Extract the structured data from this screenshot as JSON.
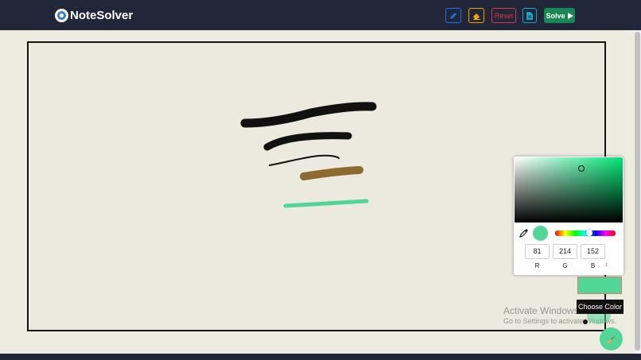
{
  "app": {
    "title": "NoteSolver"
  },
  "toolbar": {
    "pencil_icon": "pencil-icon",
    "eraser_icon": "eraser-icon",
    "reset_label": "Reset",
    "save_icon": "file-icon",
    "solve_label": "Solve",
    "solve_icon": "play-icon"
  },
  "colors": {
    "navbar": "#212638",
    "canvas": "#eceadf",
    "selected": "#51d698",
    "solve": "#198754",
    "reset": "#d9394b",
    "pencil": "#1a73e8",
    "eraser": "#f0a500"
  },
  "color_picker": {
    "r": "81",
    "g": "214",
    "b": "152",
    "r_label": "R",
    "g_label": "G",
    "b_label": "B",
    "mode_toggle": "↕",
    "eyedropper_icon": "eyedropper-icon"
  },
  "tooltip": "Choose Color",
  "watermark": {
    "title": "Activate Windows",
    "subtitle": "Go to Settings to activate Windows."
  },
  "brush_icon": "paintbrush-icon"
}
